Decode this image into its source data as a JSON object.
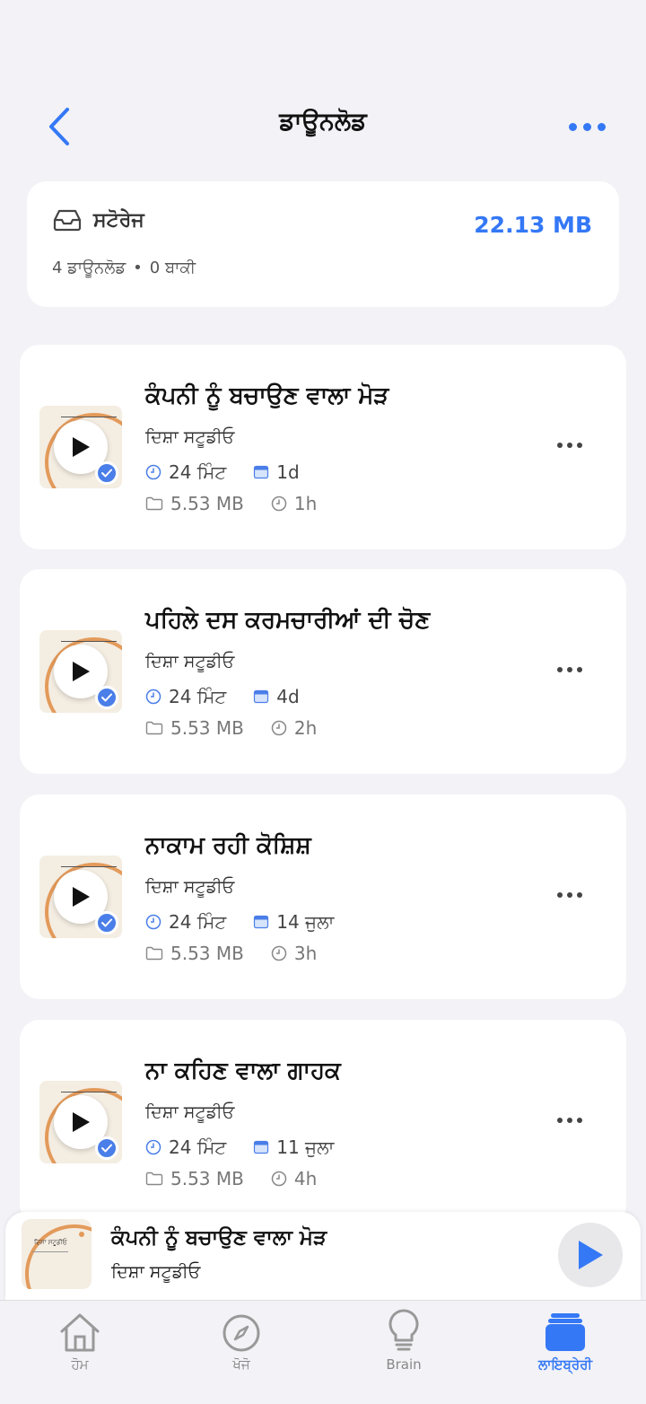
{
  "header": {
    "title": "ਡਾਊਨਲੋਡ"
  },
  "storage": {
    "label": "ਸਟੋਰੇਜ",
    "size": "22.13 MB",
    "downloads": "4 ਡਾਊਨਲੋਡ",
    "separator": "•",
    "remaining": "0 ਬਾਕੀ"
  },
  "episodes": [
    {
      "title": "ਕੰਪਨੀ ਨੂੰ ਬਚਾਉਣ ਵਾਲਾ ਮੋੜ",
      "author": "ਦਿਸ਼ਾ ਸਟੂਡੀਓ",
      "duration": "24 ਮਿੰਟ",
      "date": "1d",
      "file_size": "5.53 MB",
      "ago": "1h"
    },
    {
      "title": "ਪਹਿਲੇ ਦਸ ਕਰਮਚਾਰੀਆਂ ਦੀ ਚੋਣ",
      "author": "ਦਿਸ਼ਾ ਸਟੂਡੀਓ",
      "duration": "24 ਮਿੰਟ",
      "date": "4d",
      "file_size": "5.53 MB",
      "ago": "2h"
    },
    {
      "title": "ਨਾਕਾਮ ਰਹੀ ਕੋਸ਼ਿਸ਼",
      "author": "ਦਿਸ਼ਾ ਸਟੂਡੀਓ",
      "duration": "24 ਮਿੰਟ",
      "date": "14 ਜੁਲਾ",
      "file_size": "5.53 MB",
      "ago": "3h"
    },
    {
      "title": "ਨਾ ਕਹਿਣ ਵਾਲਾ ਗਾਹਕ",
      "author": "ਦਿਸ਼ਾ ਸਟੂਡੀਓ",
      "duration": "24 ਮਿੰਟ",
      "date": "11 ਜੁਲਾ",
      "file_size": "5.53 MB",
      "ago": "4h"
    }
  ],
  "mini_player": {
    "title": "ਕੰਪਨੀ ਨੂੰ ਬਚਾਉਣ ਵਾਲਾ ਮੋੜ",
    "author": "ਦਿਸ਼ਾ ਸਟੂਡੀਓ",
    "cover_text": "ਦਿਸ਼ਾ ਸਟੂਡੀਓ"
  },
  "tabs": [
    {
      "label": "ਹੋਮ",
      "icon": "home-icon"
    },
    {
      "label": "ਖੋਜੋ",
      "icon": "compass-icon"
    },
    {
      "label": "Brain",
      "icon": "lightbulb-icon"
    },
    {
      "label": "ਲਾਇਬ੍ਰੇਰੀ",
      "icon": "library-icon",
      "active": true
    }
  ],
  "colors": {
    "accent": "#3478f6",
    "background": "#f2f2f7",
    "thumb_orange": "#e39a5a"
  }
}
